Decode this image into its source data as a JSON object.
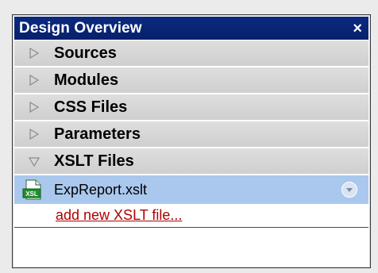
{
  "panel": {
    "title": "Design Overview",
    "close_glyph": "×"
  },
  "sections": [
    {
      "label": "Sources",
      "state": "collapsed"
    },
    {
      "label": "Modules",
      "state": "collapsed"
    },
    {
      "label": "CSS Files",
      "state": "collapsed"
    },
    {
      "label": "Parameters",
      "state": "collapsed"
    },
    {
      "label": "XSLT Files",
      "state": "expanded"
    }
  ],
  "xslt_files": {
    "items": [
      {
        "name": "ExpReport.xslt",
        "icon": "xslt-file-icon",
        "icon_text": "XSL"
      }
    ],
    "add_link": "add new XSLT file..."
  },
  "colors": {
    "title_bg": "#0b2a80",
    "section_bg": "#d6d6d6",
    "selected_row": "#aac8ee",
    "link": "#b00000"
  }
}
